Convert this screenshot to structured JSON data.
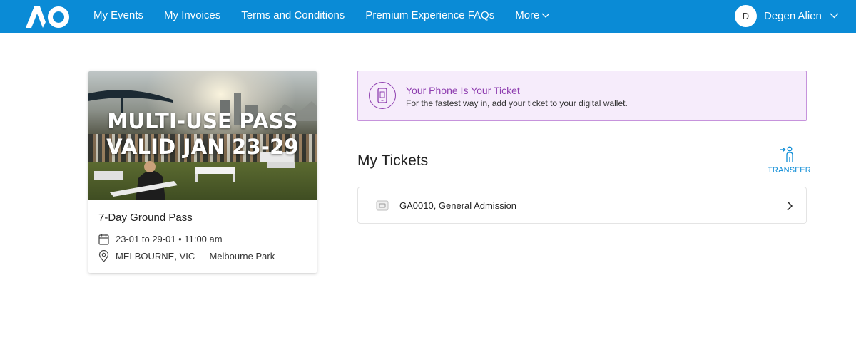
{
  "header": {
    "logo_text": "AO",
    "nav": [
      {
        "label": "My Events"
      },
      {
        "label": "My Invoices"
      },
      {
        "label": "Terms and Conditions"
      },
      {
        "label": "Premium Experience FAQs"
      }
    ],
    "more_label": "More",
    "user": {
      "initial": "D",
      "name": "Degen Alien"
    }
  },
  "event": {
    "image_text_line1": "MULTI-USE PASS",
    "image_text_line2": "VALID JAN 23-29",
    "title": "7-Day Ground Pass",
    "date": "23-01 to 29-01 • 11:00 am",
    "location": "MELBOURNE, VIC — Melbourne Park"
  },
  "notice": {
    "title": "Your Phone Is Your Ticket",
    "text": "For the fastest way in, add your ticket to your digital wallet."
  },
  "tickets": {
    "heading": "My Tickets",
    "transfer_label": "TRANSFER",
    "items": [
      {
        "label": "GA0010, General Admission"
      }
    ]
  },
  "colors": {
    "brand_blue": "#0a8bd6",
    "notice_purple": "#8f3fb0",
    "notice_bg": "#f6ecfb"
  }
}
